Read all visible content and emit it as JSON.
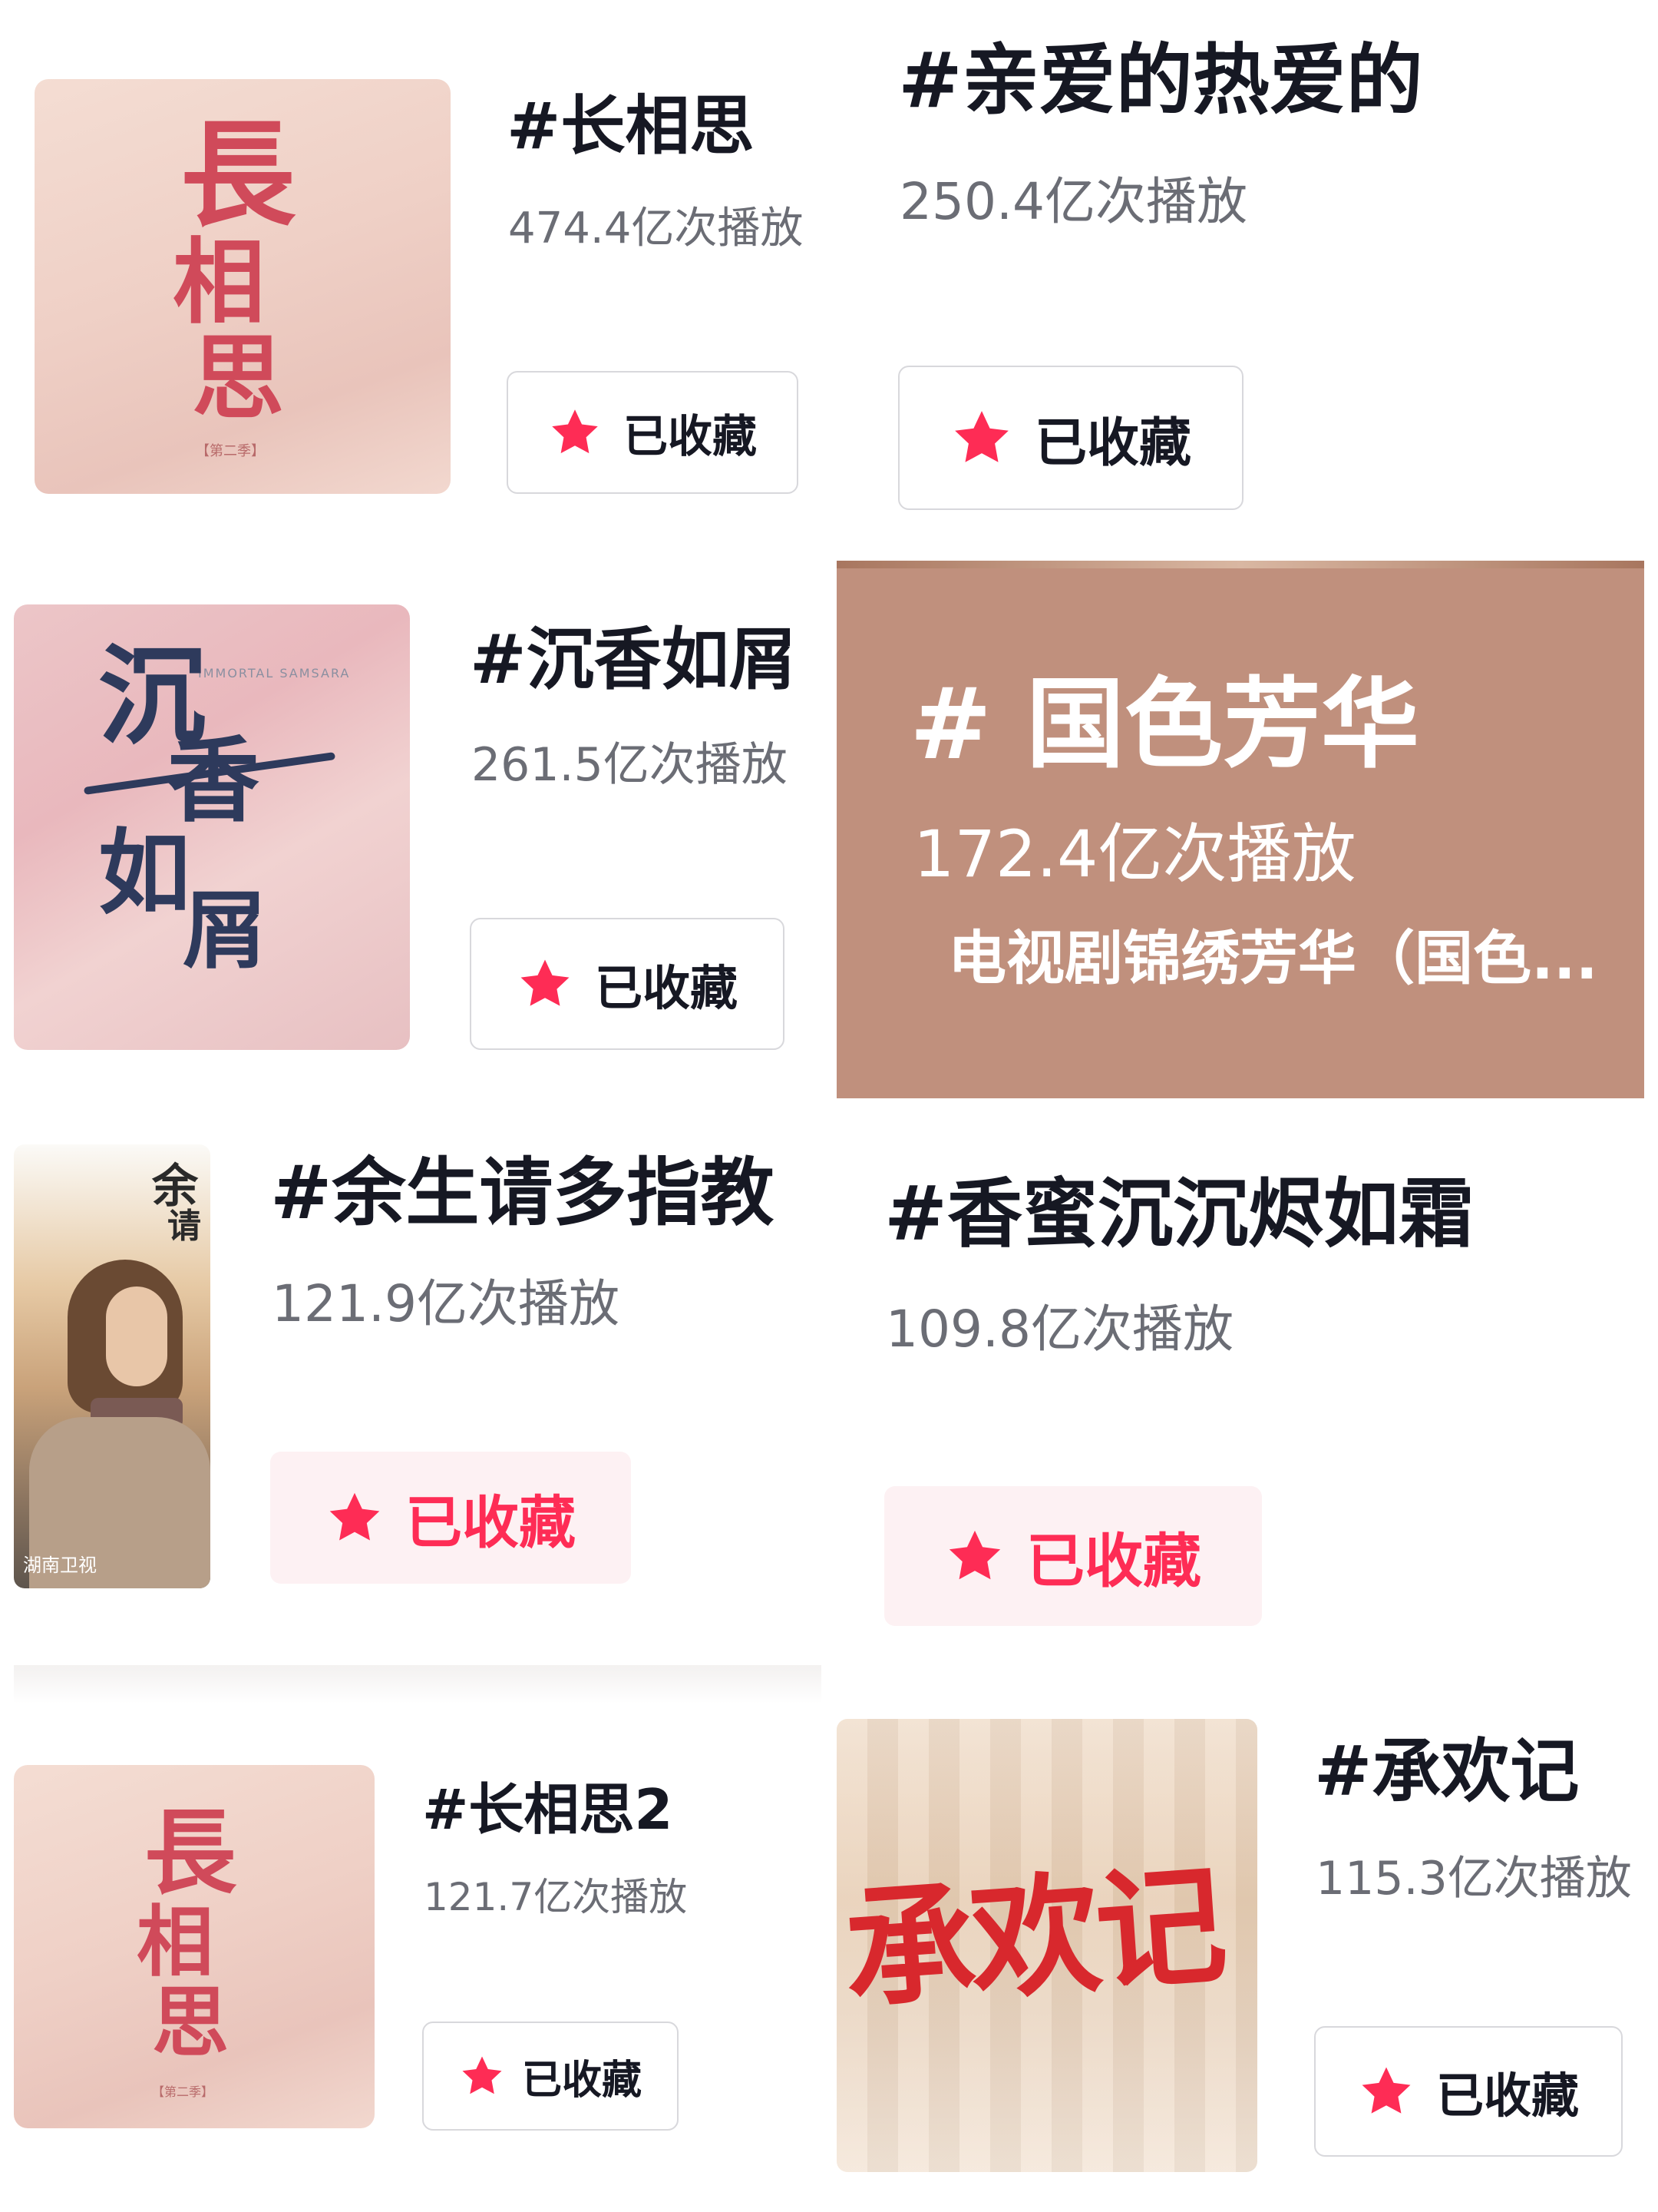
{
  "button_label": "已收藏",
  "colors": {
    "accent": "#fe2c55",
    "title": "#161823",
    "plays": "#6b6d75",
    "highlight_bg": "#c0907d"
  },
  "icons": {
    "collected": "star-icon"
  },
  "cards": [
    {
      "title": "#长相思",
      "plays": "474.4亿次播放",
      "poster": {
        "text": [
          "長",
          "相",
          "思"
        ],
        "seal": "【第二季】"
      }
    },
    {
      "title": "#亲爱的热爱的",
      "plays": "250.4亿次播放"
    },
    {
      "title": "#沉香如屑",
      "plays": "261.5亿次播放",
      "poster": {
        "text": [
          "沉",
          "香",
          "如",
          "屑"
        ],
        "subtitle": "IMMORTAL SAMSARA"
      }
    },
    {
      "title": "# 国色芳华",
      "plays": "172.4亿次播放",
      "desc": "电视剧锦绣芳华（国色..."
    },
    {
      "title": "#余生请多指教",
      "plays": "121.9亿次播放",
      "poster": {
        "text": [
          "余",
          "请"
        ],
        "channel": "湖南卫视"
      }
    },
    {
      "title": "#香蜜沉沉烬如霜",
      "plays": "109.8亿次播放"
    },
    {
      "title": "#长相思2",
      "plays": "121.7亿次播放",
      "poster": {
        "text": [
          "長",
          "相",
          "思"
        ],
        "seal": "【第二季】"
      }
    },
    {
      "title": "#承欢记",
      "plays": "115.3亿次播放",
      "poster": {
        "text": "承欢记"
      }
    }
  ]
}
